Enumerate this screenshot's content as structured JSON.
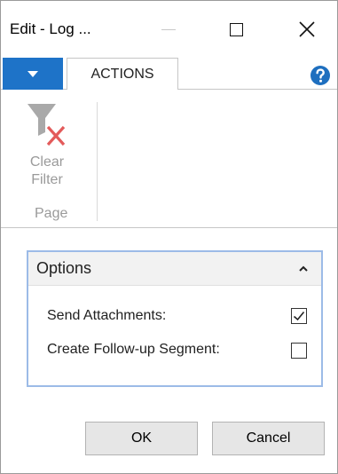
{
  "window": {
    "title": "Edit - Log ..."
  },
  "ribbon": {
    "tab_actions": "ACTIONS",
    "clear_filter_line1": "Clear",
    "clear_filter_line2": "Filter",
    "group_label": "Page"
  },
  "options": {
    "title": "Options",
    "fields": [
      {
        "label": "Send Attachments:",
        "checked": true
      },
      {
        "label": "Create Follow-up Segment:",
        "checked": false
      }
    ]
  },
  "buttons": {
    "ok": "OK",
    "cancel": "Cancel"
  },
  "icons": {
    "app_menu": "caret-down-icon",
    "help": "help-icon",
    "clear_filter": "clear-filter-icon",
    "collapse": "chevron-up-icon",
    "check": "checkmark-icon"
  },
  "colors": {
    "accent": "#1e73c8",
    "panel_border": "#9cbbe7",
    "help_icon": "#1e6fbf",
    "disabled_text": "#9a9a9a",
    "clear_x": "#e35b5b"
  }
}
